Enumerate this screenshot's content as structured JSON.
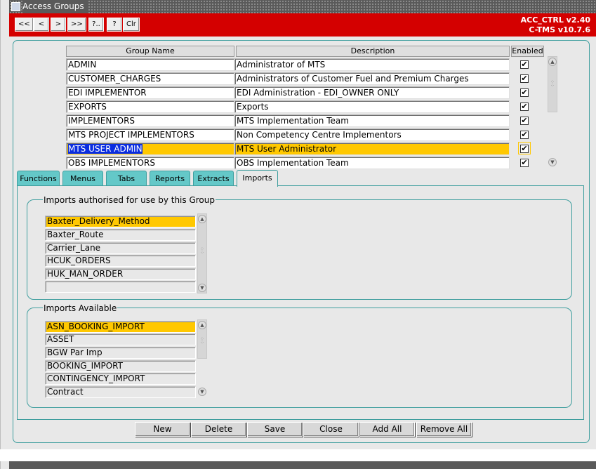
{
  "window": {
    "title": "Access Groups"
  },
  "toolbar": {
    "nav_buttons": [
      "<<",
      "<",
      ">",
      ">>",
      "?..",
      "?",
      "Clr"
    ],
    "version_line1": "ACC_CTRL v2.40",
    "version_line2": "C-TMS v10.7.6"
  },
  "groups_table": {
    "headers": {
      "group_name": "Group Name",
      "description": "Description",
      "enabled": "Enabled"
    },
    "rows": [
      {
        "group_name": "ADMIN",
        "description": "Administrator of MTS",
        "enabled": true
      },
      {
        "group_name": "CUSTOMER_CHARGES",
        "description": "Administrators of Customer Fuel and Premium Charges",
        "enabled": true
      },
      {
        "group_name": "EDI IMPLEMENTOR",
        "description": "EDI Administration - EDI_OWNER ONLY",
        "enabled": true
      },
      {
        "group_name": "EXPORTS",
        "description": "Exports",
        "enabled": true
      },
      {
        "group_name": "IMPLEMENTORS",
        "description": "MTS Implementation Team",
        "enabled": true
      },
      {
        "group_name": "MTS PROJECT IMPLEMENTORS",
        "description": "Non Competency Centre Implementors",
        "enabled": true
      },
      {
        "group_name": "MTS USER ADMIN",
        "description": "MTS User Administrator",
        "enabled": true,
        "selected": true
      },
      {
        "group_name": "OBS IMPLEMENTORS",
        "description": "OBS Implementation Team",
        "enabled": true
      }
    ],
    "check_mark": "✔"
  },
  "tabs": [
    "Functions",
    "Menus",
    "Tabs",
    "Reports",
    "Extracts",
    "Imports"
  ],
  "active_tab": "Imports",
  "authorised": {
    "legend": "Imports authorised for use by this Group",
    "items": [
      "Baxter_Delivery_Method",
      "Baxter_Route",
      "Carrier_Lane",
      "HCUK_ORDERS",
      "HUK_MAN_ORDER",
      ""
    ]
  },
  "available": {
    "legend": "Imports Available",
    "items": [
      "ASN_BOOKING_IMPORT",
      "ASSET",
      "BGW Par Imp",
      "BOOKING_IMPORT",
      "CONTINGENCY_IMPORT",
      "Contract"
    ]
  },
  "buttons": [
    "New",
    "Delete",
    "Save",
    "Close",
    "Add All",
    "Remove All"
  ],
  "colors": {
    "title_red": "#d40000",
    "selection": "#ffc800",
    "highlight": "#0a2de0",
    "accent_teal": "#3f9e9e",
    "tab_teal": "#64c8c8"
  }
}
